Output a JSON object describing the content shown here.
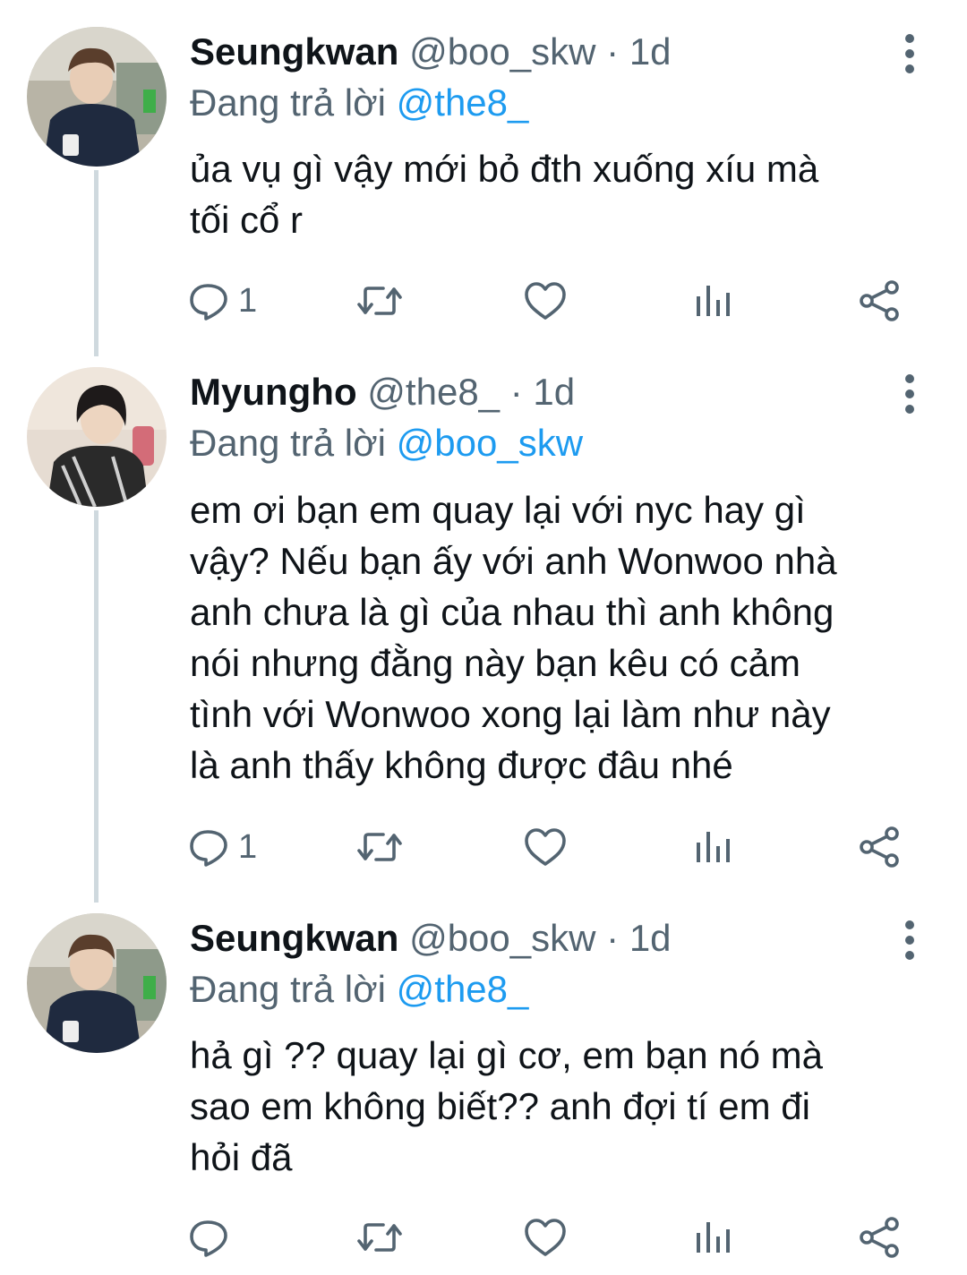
{
  "colors": {
    "text": "#0f1419",
    "secondary": "#536471",
    "mention": "#1d9bf0",
    "thread_line": "#cfd9de"
  },
  "tweets": [
    {
      "name": "Seungkwan",
      "handle": "@boo_skw",
      "dot": "·",
      "time": "1d",
      "reply_prefix": "Đang trả lời",
      "reply_to": "@the8_",
      "lines": [
        "ủa vụ gì vậy mới bỏ đth xuống xíu mà",
        "tối cổ r"
      ],
      "reply_count": "1",
      "avatar_icon": "profile-photo"
    },
    {
      "name": "Myungho",
      "handle": "@the8_",
      "dot": "·",
      "time": "1d",
      "reply_prefix": "Đang trả lời",
      "reply_to": "@boo_skw",
      "lines": [
        "em ơi bạn em quay lại với nyc hay gì",
        "vậy? Nếu bạn ấy với anh Wonwoo nhà",
        "anh chưa là gì của nhau thì anh không",
        "nói nhưng đằng này bạn kêu có cảm",
        "tình với Wonwoo xong lại làm như này",
        "là anh thấy không được đâu nhé"
      ],
      "reply_count": "1",
      "avatar_icon": "profile-photo"
    },
    {
      "name": "Seungkwan",
      "handle": "@boo_skw",
      "dot": "·",
      "time": "1d",
      "reply_prefix": "Đang trả lời",
      "reply_to": "@the8_",
      "lines": [
        "hả gì ?? quay lại gì cơ, em bạn nó mà",
        "sao em không biết?? anh đợi tí em đi",
        "hỏi đã"
      ],
      "reply_count": "",
      "avatar_icon": "profile-photo"
    }
  ],
  "action_icons": [
    "reply-icon",
    "retweet-icon",
    "like-icon",
    "analytics-icon",
    "share-icon"
  ]
}
